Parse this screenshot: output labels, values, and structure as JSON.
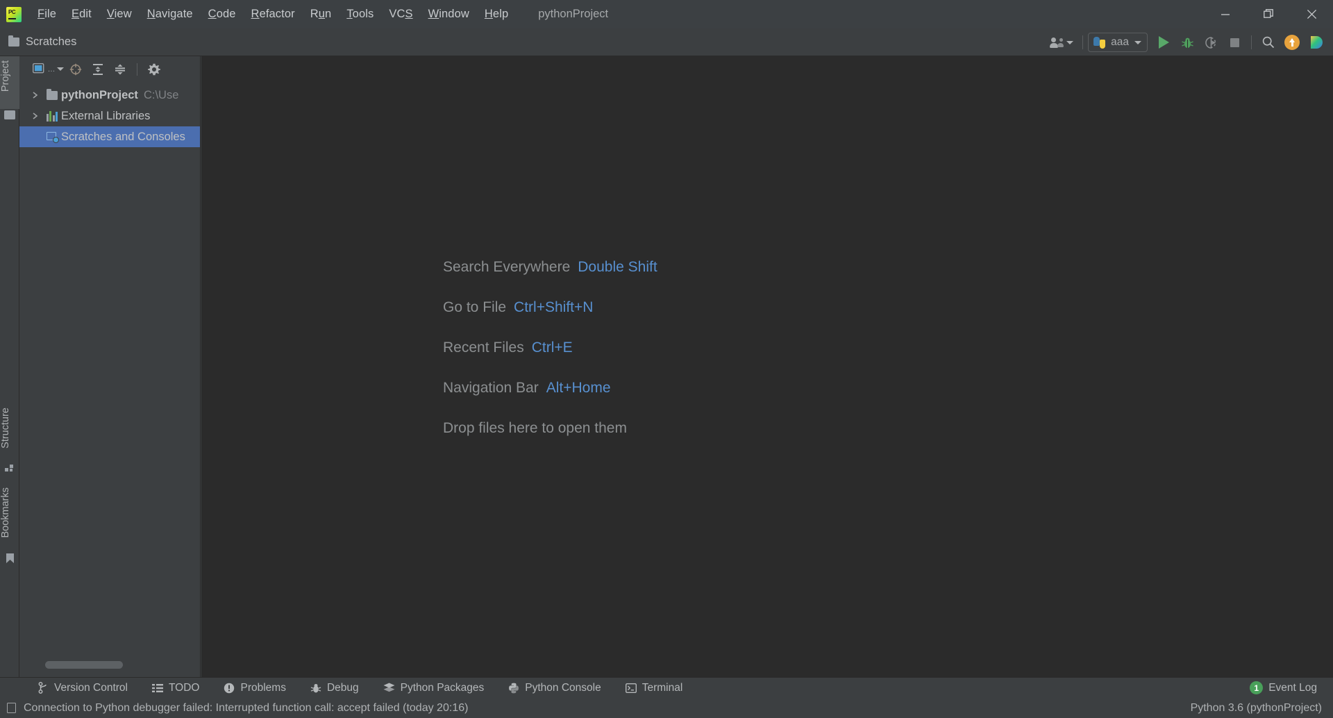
{
  "titlebar": {
    "logo": "pycharm-logo",
    "menu": [
      {
        "label": "File",
        "mnemonic": "F"
      },
      {
        "label": "Edit",
        "mnemonic": "E"
      },
      {
        "label": "View",
        "mnemonic": "V"
      },
      {
        "label": "Navigate",
        "mnemonic": "N"
      },
      {
        "label": "Code",
        "mnemonic": "C"
      },
      {
        "label": "Refactor",
        "mnemonic": "R"
      },
      {
        "label": "Run",
        "mnemonic": "u"
      },
      {
        "label": "Tools",
        "mnemonic": "T"
      },
      {
        "label": "VCS",
        "mnemonic": "S"
      },
      {
        "label": "Window",
        "mnemonic": "W"
      },
      {
        "label": "Help",
        "mnemonic": "H"
      }
    ],
    "project_title": "pythonProject",
    "minimize": "minimize",
    "maximize": "restore",
    "close": "close"
  },
  "toolbar": {
    "breadcrumb": "Scratches",
    "run_config_name": "aaa",
    "actions": [
      {
        "name": "settings-sync-account",
        "label": "Account"
      },
      {
        "name": "run",
        "label": "Run"
      },
      {
        "name": "debug",
        "label": "Debug"
      },
      {
        "name": "run-with-coverage",
        "label": "Run with Coverage"
      },
      {
        "name": "stop",
        "label": "Stop"
      },
      {
        "name": "search",
        "label": "Search Everywhere"
      },
      {
        "name": "update-project",
        "label": "Update"
      },
      {
        "name": "ai-assistant",
        "label": "AI Assistant"
      }
    ]
  },
  "left_stripe": {
    "top": [
      {
        "label": "Project",
        "selected": true,
        "icon": "folder-icon"
      }
    ],
    "bottom": [
      {
        "label": "Structure",
        "selected": false,
        "icon": "structure-icon"
      },
      {
        "label": "Bookmarks",
        "selected": false,
        "icon": "bookmark-icon"
      }
    ]
  },
  "project_panel": {
    "toolbar_buttons": [
      {
        "name": "project-view-selector",
        "label": "Project"
      },
      {
        "name": "select-opened-file",
        "label": "Select Opened File"
      },
      {
        "name": "expand-all",
        "label": "Expand All"
      },
      {
        "name": "collapse-all",
        "label": "Collapse All"
      },
      {
        "name": "settings",
        "label": "Options"
      }
    ],
    "tree": [
      {
        "name": "pythonProject",
        "path": "C:\\Use",
        "bold": true,
        "icon": "folder-icon",
        "expandable": true,
        "selected": false,
        "indent": 0
      },
      {
        "name": "External Libraries",
        "path": "",
        "bold": false,
        "icon": "libraries-icon",
        "expandable": true,
        "selected": false,
        "indent": 0
      },
      {
        "name": "Scratches and Consoles",
        "path": "",
        "bold": false,
        "icon": "scratches-icon",
        "expandable": false,
        "selected": true,
        "indent": 0
      }
    ]
  },
  "editor": {
    "hints": [
      {
        "label": "Search Everywhere",
        "shortcut": "Double Shift"
      },
      {
        "label": "Go to File",
        "shortcut": "Ctrl+Shift+N"
      },
      {
        "label": "Recent Files",
        "shortcut": "Ctrl+E"
      },
      {
        "label": "Navigation Bar",
        "shortcut": "Alt+Home"
      },
      {
        "label": "Drop files here to open them",
        "shortcut": ""
      }
    ]
  },
  "bottom_bar": {
    "items": [
      {
        "label": "Version Control",
        "icon": "branch-icon"
      },
      {
        "label": "TODO",
        "icon": "list-icon"
      },
      {
        "label": "Problems",
        "icon": "exclamation-icon"
      },
      {
        "label": "Debug",
        "icon": "bug-icon"
      },
      {
        "label": "Python Packages",
        "icon": "layers-icon"
      },
      {
        "label": "Python Console",
        "icon": "python-icon"
      },
      {
        "label": "Terminal",
        "icon": "terminal-icon"
      }
    ],
    "event_log": {
      "label": "Event Log",
      "count": "1"
    }
  },
  "status_bar": {
    "message": "Connection to Python debugger failed: Interrupted function call: accept failed (today 20:16)",
    "interpreter": "Python 3.6 (pythonProject)"
  },
  "colors": {
    "accent_blue": "#5890d0",
    "selection_blue": "#4b6eaf",
    "editor_bg": "#2b2b2b",
    "panel_bg": "#3c3f41",
    "titlebar_bg": "#3c4043",
    "run_green": "#59a869",
    "update_orange": "#e8a33d"
  }
}
